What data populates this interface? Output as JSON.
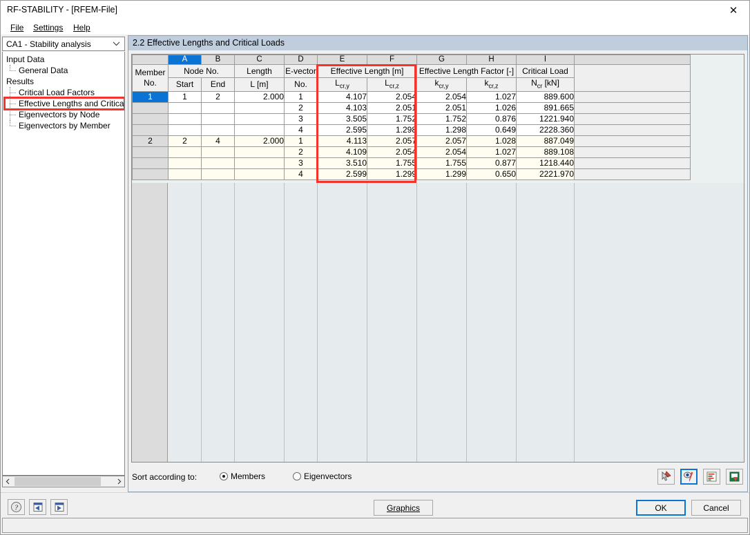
{
  "window": {
    "title": "RF-STABILITY - [RFEM-File]",
    "close_label": "✕"
  },
  "menu": [
    {
      "label": "File",
      "accel": "F"
    },
    {
      "label": "Settings",
      "accel": "S"
    },
    {
      "label": "Help",
      "accel": "H"
    }
  ],
  "sidebar": {
    "combo_value": "CA1 - Stability analysis",
    "tree": [
      {
        "label": "Input Data",
        "level": 0
      },
      {
        "label": "General Data",
        "level": 1
      },
      {
        "label": "Results",
        "level": 0
      },
      {
        "label": "Critical Load Factors",
        "level": 1
      },
      {
        "label": "Effective Lengths and Critical Lo",
        "level": 1,
        "highlighted": true
      },
      {
        "label": "Eigenvectors by Node",
        "level": 1
      },
      {
        "label": "Eigenvectors by Member",
        "level": 1
      }
    ]
  },
  "panel": {
    "title": "2.2 Effective Lengths and Critical Loads"
  },
  "table": {
    "column_letters": [
      "",
      "A",
      "B",
      "C",
      "D",
      "E",
      "F",
      "G",
      "H",
      "I"
    ],
    "selected_letter": "A",
    "groups": [
      {
        "label": "Member",
        "sub": "No.",
        "span": 1
      },
      {
        "label": "Node No.",
        "sub": "",
        "span": 2
      },
      {
        "label": "Length",
        "sub": "L [m]",
        "span": 1
      },
      {
        "label": "E-vector",
        "sub": "No.",
        "span": 1
      },
      {
        "label": "Effective Length [m]",
        "sub": "",
        "span": 2
      },
      {
        "label": "Effective Length Factor [-]",
        "sub": "",
        "span": 2
      },
      {
        "label": "Critical Load",
        "sub": "N",
        "span": 1
      }
    ],
    "headers": {
      "member": "Member",
      "member_sub": "No.",
      "node_no": "Node No.",
      "start": "Start",
      "end": "End",
      "length": "Length",
      "length_sub": "L [m]",
      "evector": "E-vector",
      "evector_sub": "No.",
      "eff_len": "Effective Length [m]",
      "eff_len_y": "L",
      "eff_len_y_sub": "cr,y",
      "eff_len_z": "L",
      "eff_len_z_sub": "cr,z",
      "eff_fac": "Effective Length Factor [-]",
      "eff_fac_y": "k",
      "eff_fac_y_sub": "cr,y",
      "eff_fac_z": "k",
      "eff_fac_z_sub": "cr,z",
      "crit_load": "Critical Load",
      "crit_load_sym": "N",
      "crit_load_sub": "cr",
      "crit_load_unit": " [kN]"
    },
    "rows": [
      {
        "rowhdr": "1",
        "selected": true,
        "alt": false,
        "member": "1",
        "start": "1",
        "end": "2",
        "length": "2.000",
        "evector": "1",
        "lcry": "4.107",
        "lcrz": "2.054",
        "kcry": "2.054",
        "kcrz": "1.027",
        "ncr": "889.600"
      },
      {
        "rowhdr": "",
        "selected": false,
        "alt": false,
        "member": "",
        "start": "",
        "end": "",
        "length": "",
        "evector": "2",
        "lcry": "4.103",
        "lcrz": "2.051",
        "kcry": "2.051",
        "kcrz": "1.026",
        "ncr": "891.665"
      },
      {
        "rowhdr": "",
        "selected": false,
        "alt": false,
        "member": "",
        "start": "",
        "end": "",
        "length": "",
        "evector": "3",
        "lcry": "3.505",
        "lcrz": "1.752",
        "kcry": "1.752",
        "kcrz": "0.876",
        "ncr": "1221.940"
      },
      {
        "rowhdr": "",
        "selected": false,
        "alt": false,
        "member": "",
        "start": "",
        "end": "",
        "length": "",
        "evector": "4",
        "lcry": "2.595",
        "lcrz": "1.298",
        "kcry": "1.298",
        "kcrz": "0.649",
        "ncr": "2228.360"
      },
      {
        "rowhdr": "2",
        "selected": false,
        "alt": true,
        "member": "2",
        "start": "2",
        "end": "4",
        "length": "2.000",
        "evector": "1",
        "lcry": "4.113",
        "lcrz": "2.057",
        "kcry": "2.057",
        "kcrz": "1.028",
        "ncr": "887.049"
      },
      {
        "rowhdr": "",
        "selected": false,
        "alt": true,
        "member": "",
        "start": "",
        "end": "",
        "length": "",
        "evector": "2",
        "lcry": "4.109",
        "lcrz": "2.054",
        "kcry": "2.054",
        "kcrz": "1.027",
        "ncr": "889.108"
      },
      {
        "rowhdr": "",
        "selected": false,
        "alt": true,
        "member": "",
        "start": "",
        "end": "",
        "length": "",
        "evector": "3",
        "lcry": "3.510",
        "lcrz": "1.755",
        "kcry": "1.755",
        "kcrz": "0.877",
        "ncr": "1218.440"
      },
      {
        "rowhdr": "",
        "selected": false,
        "alt": true,
        "member": "",
        "start": "",
        "end": "",
        "length": "",
        "evector": "4",
        "lcry": "2.599",
        "lcrz": "1.299",
        "kcry": "1.299",
        "kcrz": "0.650",
        "ncr": "2221.970"
      }
    ]
  },
  "sort": {
    "label": "Sort according to:",
    "members": "Members",
    "members_accel": "M",
    "eigenvectors": "Eigenvectors",
    "eigenvectors_accel": "E",
    "selected": "Members"
  },
  "toolbuttons": [
    {
      "name": "pick-tool",
      "active": false
    },
    {
      "name": "visibility-tool",
      "active": true
    },
    {
      "name": "list-filter-tool",
      "active": false
    },
    {
      "name": "excel-export-tool",
      "active": false
    }
  ],
  "buttons": {
    "graphics": "Graphics",
    "graphics_accel": "G",
    "ok": "OK",
    "cancel": "Cancel"
  },
  "colors": {
    "highlight_red": "#f4342c",
    "selection_blue": "#0a73d4",
    "panel_header": "#bfcddc",
    "alt_row": "#fffdf0"
  }
}
